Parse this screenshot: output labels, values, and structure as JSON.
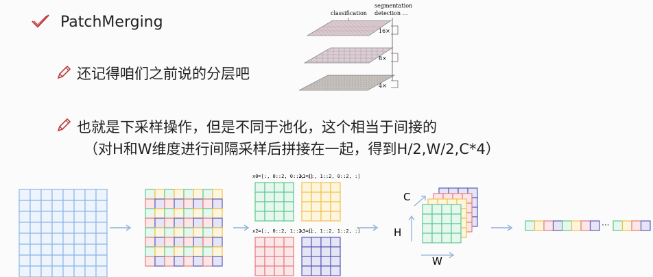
{
  "heading": "PatchMerging",
  "bullet1": "还记得咱们之前说的分层吧",
  "bullet2_line1": "也就是下采样操作，但是不同于池化，这个相当于间接的",
  "bullet2_line2": "（对H和W维度进行间隔采样后拼接在一起，得到H/2,W/2,C*4）",
  "figure": {
    "classification": "classification",
    "segmentation": "segmentation",
    "detection": "detection …",
    "scale_16": "16×",
    "scale_8": "8×",
    "scale_4": "4×"
  },
  "slices": {
    "x0": "x0=[:, 0::2, 0::2, :]",
    "x1": "x1=[:, 1::2, 0::2, :]",
    "x2": "x2=[:, 0::2, 1::2, :]",
    "x3": "x3=[:, 1::2, 1::2, :]"
  },
  "axes": {
    "c": "C",
    "h": "H",
    "w": "W"
  },
  "ellipsis": "···",
  "colors": {
    "blue_grid": "#8ab4e8",
    "green": "#5cc98f",
    "yellow": "#f1c24a",
    "red": "#e37b82",
    "purple": "#5a5ab8",
    "arrow": "#8fb0d8",
    "check_red": "#c0393b"
  }
}
